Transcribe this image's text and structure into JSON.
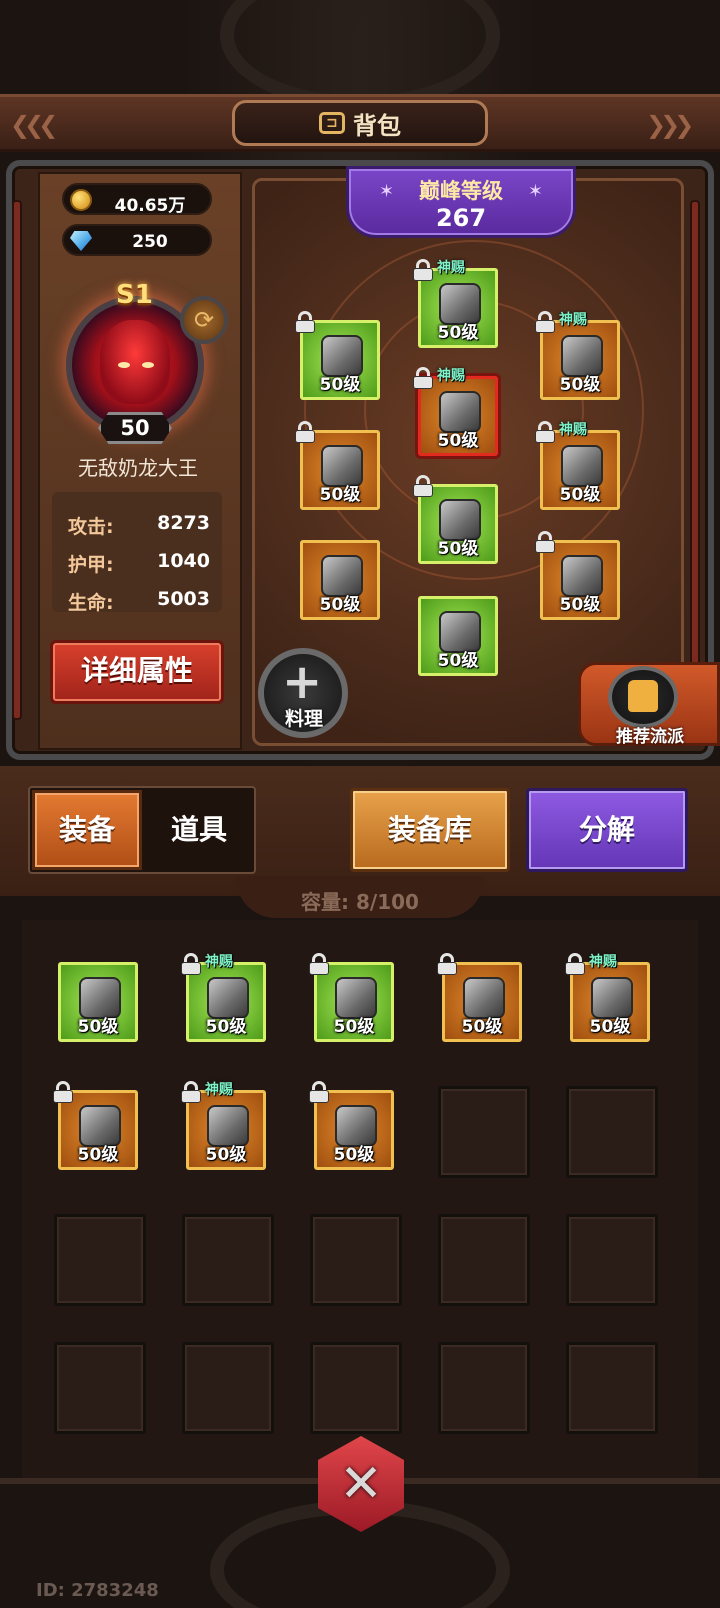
{
  "header": {
    "title": "背包"
  },
  "currency": {
    "gold": "40.65万",
    "gems": "250"
  },
  "hero": {
    "rank": "S1",
    "level": "50",
    "name": "无敌奶龙大王",
    "stats": [
      {
        "label": "攻击:",
        "value": "8273"
      },
      {
        "label": "护甲:",
        "value": "1040"
      },
      {
        "label": "生命:",
        "value": "5003"
      }
    ],
    "detail_button": "详细属性"
  },
  "peak": {
    "title": "巅峰等级",
    "value": "267"
  },
  "equipped": [
    {
      "id": "head",
      "level": "50级",
      "blessed": "神赐",
      "locked": true,
      "rarity": "green",
      "icon": "dragon-helmet-icon"
    },
    {
      "id": "shoulder",
      "level": "50级",
      "blessed": "",
      "locked": true,
      "rarity": "green",
      "icon": "shoulder-armor-icon"
    },
    {
      "id": "necklace",
      "level": "50级",
      "blessed": "神赐",
      "locked": true,
      "rarity": "orange",
      "icon": "amulet-icon"
    },
    {
      "id": "chest",
      "level": "50级",
      "blessed": "神赐",
      "locked": true,
      "rarity": "red",
      "icon": "chest-armor-icon"
    },
    {
      "id": "gloves",
      "level": "50级",
      "blessed": "",
      "locked": true,
      "rarity": "orange",
      "icon": "gauntlet-icon"
    },
    {
      "id": "ring",
      "level": "50级",
      "blessed": "神赐",
      "locked": true,
      "rarity": "orange",
      "icon": "ring-icon"
    },
    {
      "id": "pants",
      "level": "50级",
      "blessed": "",
      "locked": true,
      "rarity": "green",
      "icon": "leg-armor-icon"
    },
    {
      "id": "weapon",
      "level": "50级",
      "blessed": "",
      "locked": false,
      "rarity": "orange",
      "icon": "mace-icon"
    },
    {
      "id": "trinket",
      "level": "50级",
      "blessed": "",
      "locked": true,
      "rarity": "orange",
      "icon": "horn-icon"
    },
    {
      "id": "boots",
      "level": "50级",
      "blessed": "",
      "locked": false,
      "rarity": "green",
      "icon": "boots-icon"
    }
  ],
  "actions": {
    "cook": "料理",
    "recommend": "推荐流派"
  },
  "tabs": {
    "equip": "装备",
    "items": "道具",
    "warehouse": "装备库",
    "dismantle": "分解"
  },
  "capacity": "容量: 8/100",
  "inventory": [
    {
      "level": "50级",
      "blessed": "",
      "locked": false,
      "rarity": "green",
      "icon": "plumed-helmet-icon"
    },
    {
      "level": "50级",
      "blessed": "神赐",
      "locked": true,
      "rarity": "green",
      "icon": "chest-armor-icon"
    },
    {
      "level": "50级",
      "blessed": "",
      "locked": true,
      "rarity": "green",
      "icon": "gauntlet-icon"
    },
    {
      "level": "50级",
      "blessed": "",
      "locked": true,
      "rarity": "orange",
      "icon": "bronze-gauntlet-icon"
    },
    {
      "level": "50级",
      "blessed": "神赐",
      "locked": true,
      "rarity": "orange",
      "icon": "bronze-glove-icon"
    },
    {
      "level": "50级",
      "blessed": "",
      "locked": true,
      "rarity": "orange",
      "icon": "gold-boots-icon"
    },
    {
      "level": "50级",
      "blessed": "神赐",
      "locked": true,
      "rarity": "orange",
      "icon": "winged-boots-icon"
    },
    {
      "level": "50级",
      "blessed": "",
      "locked": true,
      "rarity": "orange",
      "icon": "wolf-amulet-icon"
    }
  ],
  "inventory_slots_visible": 20,
  "user_id": "ID: 2783248",
  "colors": {
    "green_rarity": "#7cc83a",
    "orange_rarity": "#d47a22",
    "purple_button": "#7a4ad0",
    "red_button": "#c8332a"
  }
}
